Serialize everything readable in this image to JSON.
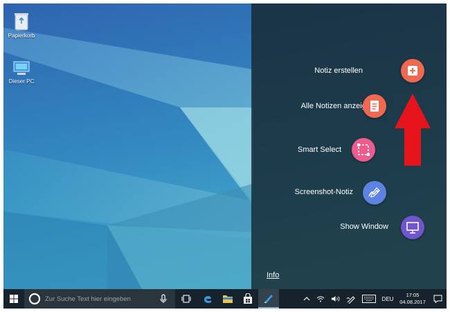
{
  "desktop": {
    "icons": [
      {
        "label": "Papierkorb",
        "icon": "recycle-bin-icon"
      },
      {
        "label": "Dieser PC",
        "icon": "this-pc-icon"
      }
    ]
  },
  "note_menu": {
    "items": [
      {
        "label": "Notiz erstellen",
        "icon": "add-note-icon",
        "color": "#f0684f"
      },
      {
        "label": "Alle Notizen anzeigen",
        "icon": "notes-list-icon",
        "color": "#f0684f"
      },
      {
        "label": "Smart Select",
        "icon": "smart-select-icon",
        "color": "#ee5c8d"
      },
      {
        "label": "Screenshot-Notiz",
        "icon": "screen-write-icon",
        "color": "#5c82e2"
      },
      {
        "label": "Show Window",
        "icon": "show-window-icon",
        "color": "#6f56cc"
      }
    ],
    "info_label": "Info"
  },
  "annotation": {
    "arrow_color": "#e8141b",
    "arrow_icon": "red-up-arrow-icon"
  },
  "taskbar": {
    "start_icon": "windows-start-icon",
    "cortana_icon": "cortana-circle-icon",
    "search_placeholder": "Zur Suche Text hier eingeben",
    "mic_icon": "microphone-icon",
    "pinned": [
      "task-view-icon",
      "edge-icon",
      "file-explorer-icon",
      "store-icon",
      "pen-app-icon"
    ],
    "tray": {
      "chevron_icon": "chevron-up-icon",
      "network_icon": "wifi-icon",
      "volume_icon": "volume-icon",
      "pen_icon": "pen-workspace-icon",
      "keyboard_icon": "touch-keyboard-icon",
      "language": "DEU",
      "time": "17:05",
      "date": "04.08.2017",
      "notification_icon": "action-center-icon"
    }
  },
  "colors": {
    "overlay": "#16262c",
    "taskbar": "#16222c",
    "accent": "#8ab4d8"
  }
}
